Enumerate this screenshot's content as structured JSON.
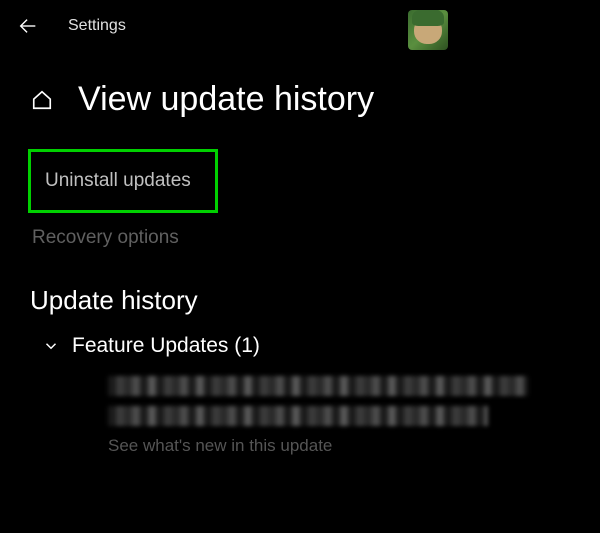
{
  "header": {
    "title": "Settings"
  },
  "page": {
    "title": "View update history"
  },
  "links": {
    "uninstall_updates": "Uninstall updates",
    "recovery_options": "Recovery options"
  },
  "history": {
    "heading": "Update history",
    "feature_updates_label": "Feature Updates (1)",
    "see_whats_new": "See what's new in this update"
  }
}
